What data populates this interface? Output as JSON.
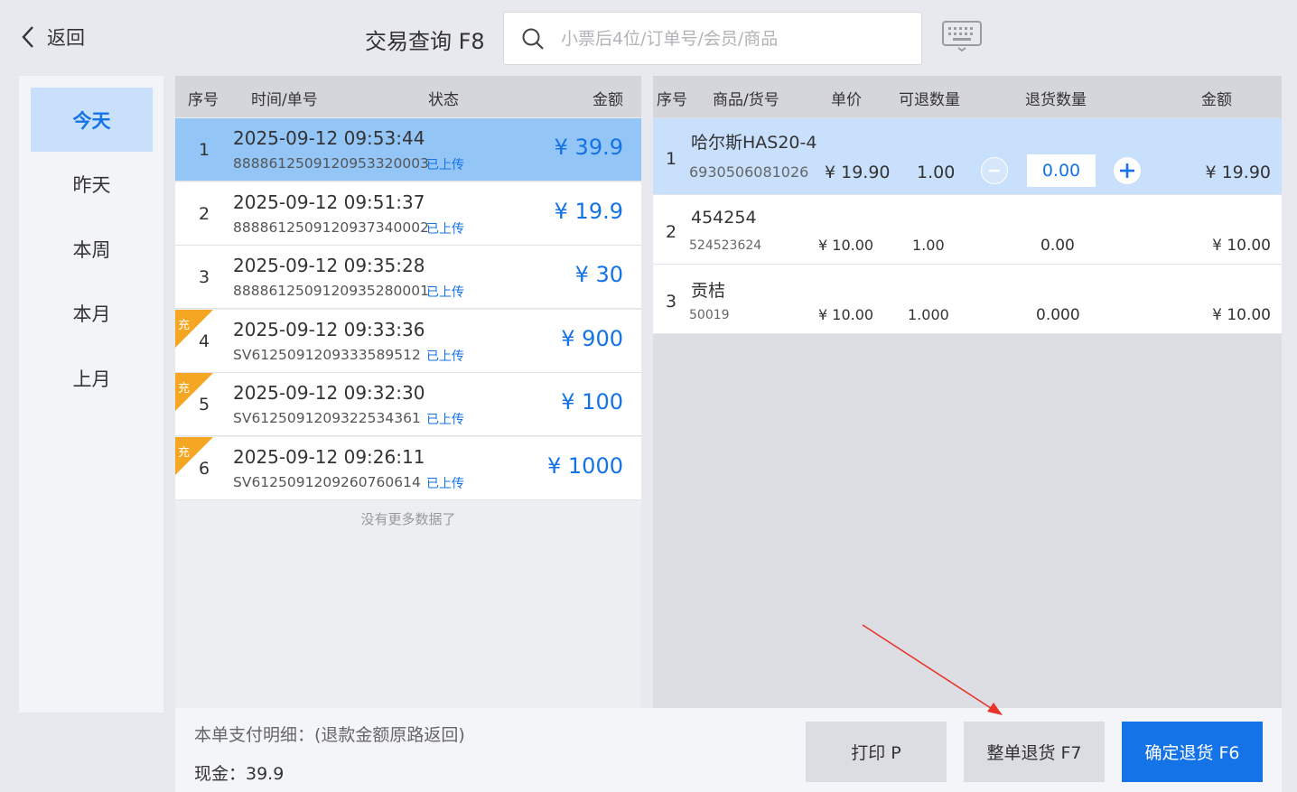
{
  "header": {
    "back_label": "返回",
    "title": "交易查询 F8",
    "search_placeholder": "小票后4位/订单号/会员/商品"
  },
  "date_nav": [
    {
      "label": "今天",
      "active": true
    },
    {
      "label": "昨天",
      "active": false
    },
    {
      "label": "本周",
      "active": false
    },
    {
      "label": "本月",
      "active": false
    },
    {
      "label": "上月",
      "active": false
    }
  ],
  "transactions": {
    "columns": {
      "no": "序号",
      "time": "时间/单号",
      "status": "状态",
      "amount": "金额"
    },
    "rows": [
      {
        "no": "1",
        "time": "2025-09-12 09:53:44",
        "order": "8888612509120953320003",
        "status": "已上传",
        "amount": "¥ 39.9",
        "selected": true,
        "recharge": false
      },
      {
        "no": "2",
        "time": "2025-09-12 09:51:37",
        "order": "8888612509120937340002",
        "status": "已上传",
        "amount": "¥ 19.9",
        "selected": false,
        "recharge": false
      },
      {
        "no": "3",
        "time": "2025-09-12 09:35:28",
        "order": "8888612509120935280001",
        "status": "已上传",
        "amount": "¥ 30",
        "selected": false,
        "recharge": false
      },
      {
        "no": "4",
        "time": "2025-09-12 09:33:36",
        "order": "SV6125091209333589512",
        "status": "已上传",
        "amount": "¥ 900",
        "selected": false,
        "recharge": true
      },
      {
        "no": "5",
        "time": "2025-09-12 09:32:30",
        "order": "SV6125091209322534361",
        "status": "已上传",
        "amount": "¥ 100",
        "selected": false,
        "recharge": true
      },
      {
        "no": "6",
        "time": "2025-09-12 09:26:11",
        "order": "SV6125091209260760614",
        "status": "已上传",
        "amount": "¥ 1000",
        "selected": false,
        "recharge": true
      }
    ],
    "recharge_label": "充",
    "no_more": "没有更多数据了"
  },
  "details": {
    "columns": {
      "no": "序号",
      "product": "商品/货号",
      "price": "单价",
      "returnable": "可退数量",
      "return_qty": "退货数量",
      "amount": "金额"
    },
    "rows": [
      {
        "no": "1",
        "name": "哈尔斯HAS20-4",
        "code": "6930506081026",
        "price": "¥ 19.90",
        "returnable": "1.00",
        "return_qty": "0.00",
        "amount": "¥ 19.90",
        "selected": true
      },
      {
        "no": "2",
        "name": "454254",
        "code": "524523624",
        "price": "¥ 10.00",
        "returnable": "1.00",
        "return_qty": "0.00",
        "amount": "¥ 10.00",
        "selected": false
      },
      {
        "no": "3",
        "name": "贡桔",
        "code": "50019",
        "price": "¥ 10.00",
        "returnable": "1.000",
        "return_qty": "0.000",
        "amount": "¥ 10.00",
        "selected": false
      }
    ]
  },
  "footer": {
    "payment_title": "本单支付明细：(退款金额原路返回)",
    "payment_cash": "现金：39.9",
    "print_label": "打印 P",
    "full_return_label": "整单退货 F7",
    "confirm_return_label": "确定退货 F6"
  },
  "colors": {
    "accent": "#1473e6",
    "selected_row": "#93c5f7",
    "selected_detail": "#c8e0fb",
    "recharge_tag": "#f5a623",
    "arrow": "#e8352c"
  }
}
